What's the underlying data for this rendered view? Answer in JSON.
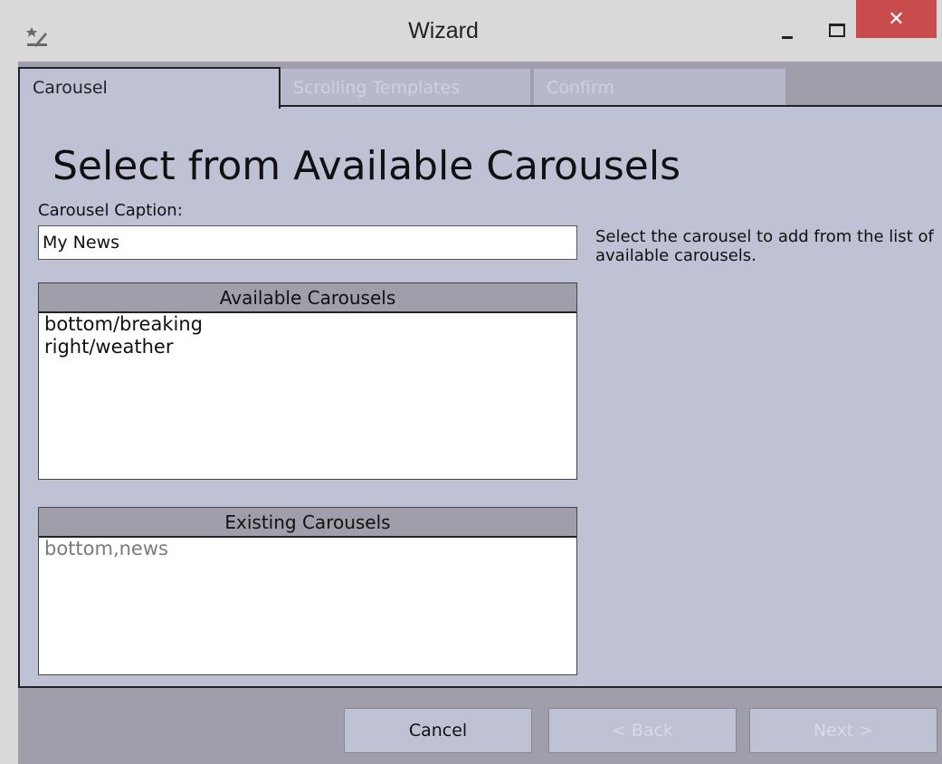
{
  "window": {
    "title": "Wizard",
    "close_glyph": "✕"
  },
  "tabs": [
    {
      "label": "Carousel",
      "state": "active"
    },
    {
      "label": "Scrolling Templates",
      "state": "disabled"
    },
    {
      "label": "Confirm",
      "state": "disabled"
    }
  ],
  "page": {
    "heading": "Select from Available Carousels",
    "caption_label": "Carousel Caption:",
    "caption_value": "My News",
    "help_text": "Select the carousel to add from the list of available carousels."
  },
  "available": {
    "header": "Available Carousels",
    "items": [
      "bottom/breaking",
      "right/weather"
    ]
  },
  "existing": {
    "header": "Existing Carousels",
    "items": [
      "bottom,news"
    ]
  },
  "buttons": {
    "cancel": "Cancel",
    "back": "< Back",
    "next": "Next >"
  },
  "colors": {
    "panel": "#bfc1d4",
    "header_band": "#a09eaa",
    "close_button": "#c94c4c"
  },
  "icons": {
    "app": "wizard-wand-icon",
    "minimize": "minimize-icon",
    "maximize": "maximize-icon",
    "close": "close-icon"
  }
}
